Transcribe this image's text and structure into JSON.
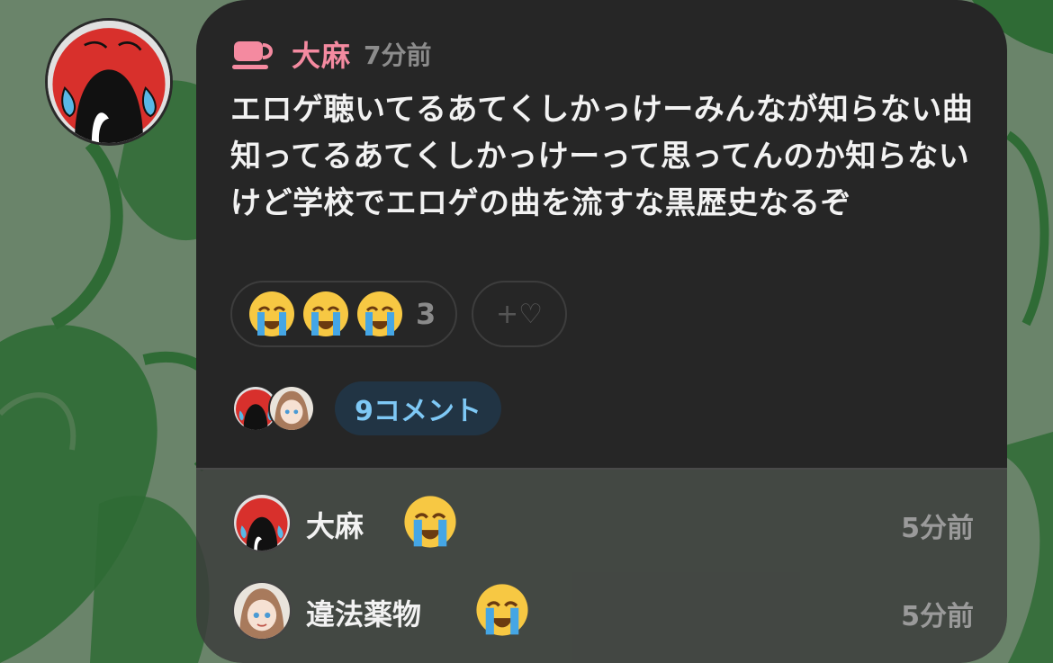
{
  "post": {
    "author": "大麻",
    "time": "7分前",
    "text": "エロゲ聴いてるあてくしかっけーみんなが知らない曲知ってるあてくしかっけーって思ってんのか知らないけど学校でエロゲの曲を流すな黒歴史なるぞ",
    "reactions": {
      "emoji": "loudly-crying-face",
      "count": "3",
      "add_label": "+♡"
    },
    "comment_count_label": "9コメント"
  },
  "replies": [
    {
      "name": "大麻",
      "emoji": "loudly-crying-face",
      "time": "5分前"
    },
    {
      "name": "違法薬物",
      "emoji": "loudly-crying-face",
      "time": "5分前"
    }
  ],
  "colors": {
    "author_name": "#f48aa0",
    "comment_pill_bg": "#213444",
    "comment_pill_text": "#7ec8f5",
    "card_bg": "#262626",
    "background_green": "#2f6b35"
  }
}
